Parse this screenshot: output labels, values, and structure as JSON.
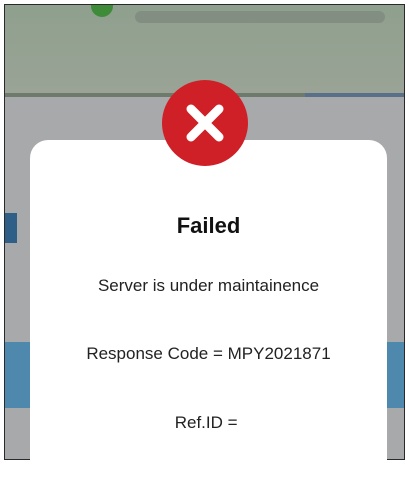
{
  "dialog": {
    "title": "Failed",
    "message": "Server is under maintainence",
    "response_code_label": "Response Code = ",
    "response_code_value": "MPY2021871",
    "ref_id_label": "Ref.ID = ",
    "ref_id_value": ""
  },
  "icons": {
    "status": "close-icon",
    "background_check": "check-circle-icon"
  },
  "colors": {
    "error_red": "#cf2027",
    "dialog_bg": "#ffffff",
    "overlay_gray": "#a7a9ab",
    "background_blue": "#4f88ad"
  }
}
